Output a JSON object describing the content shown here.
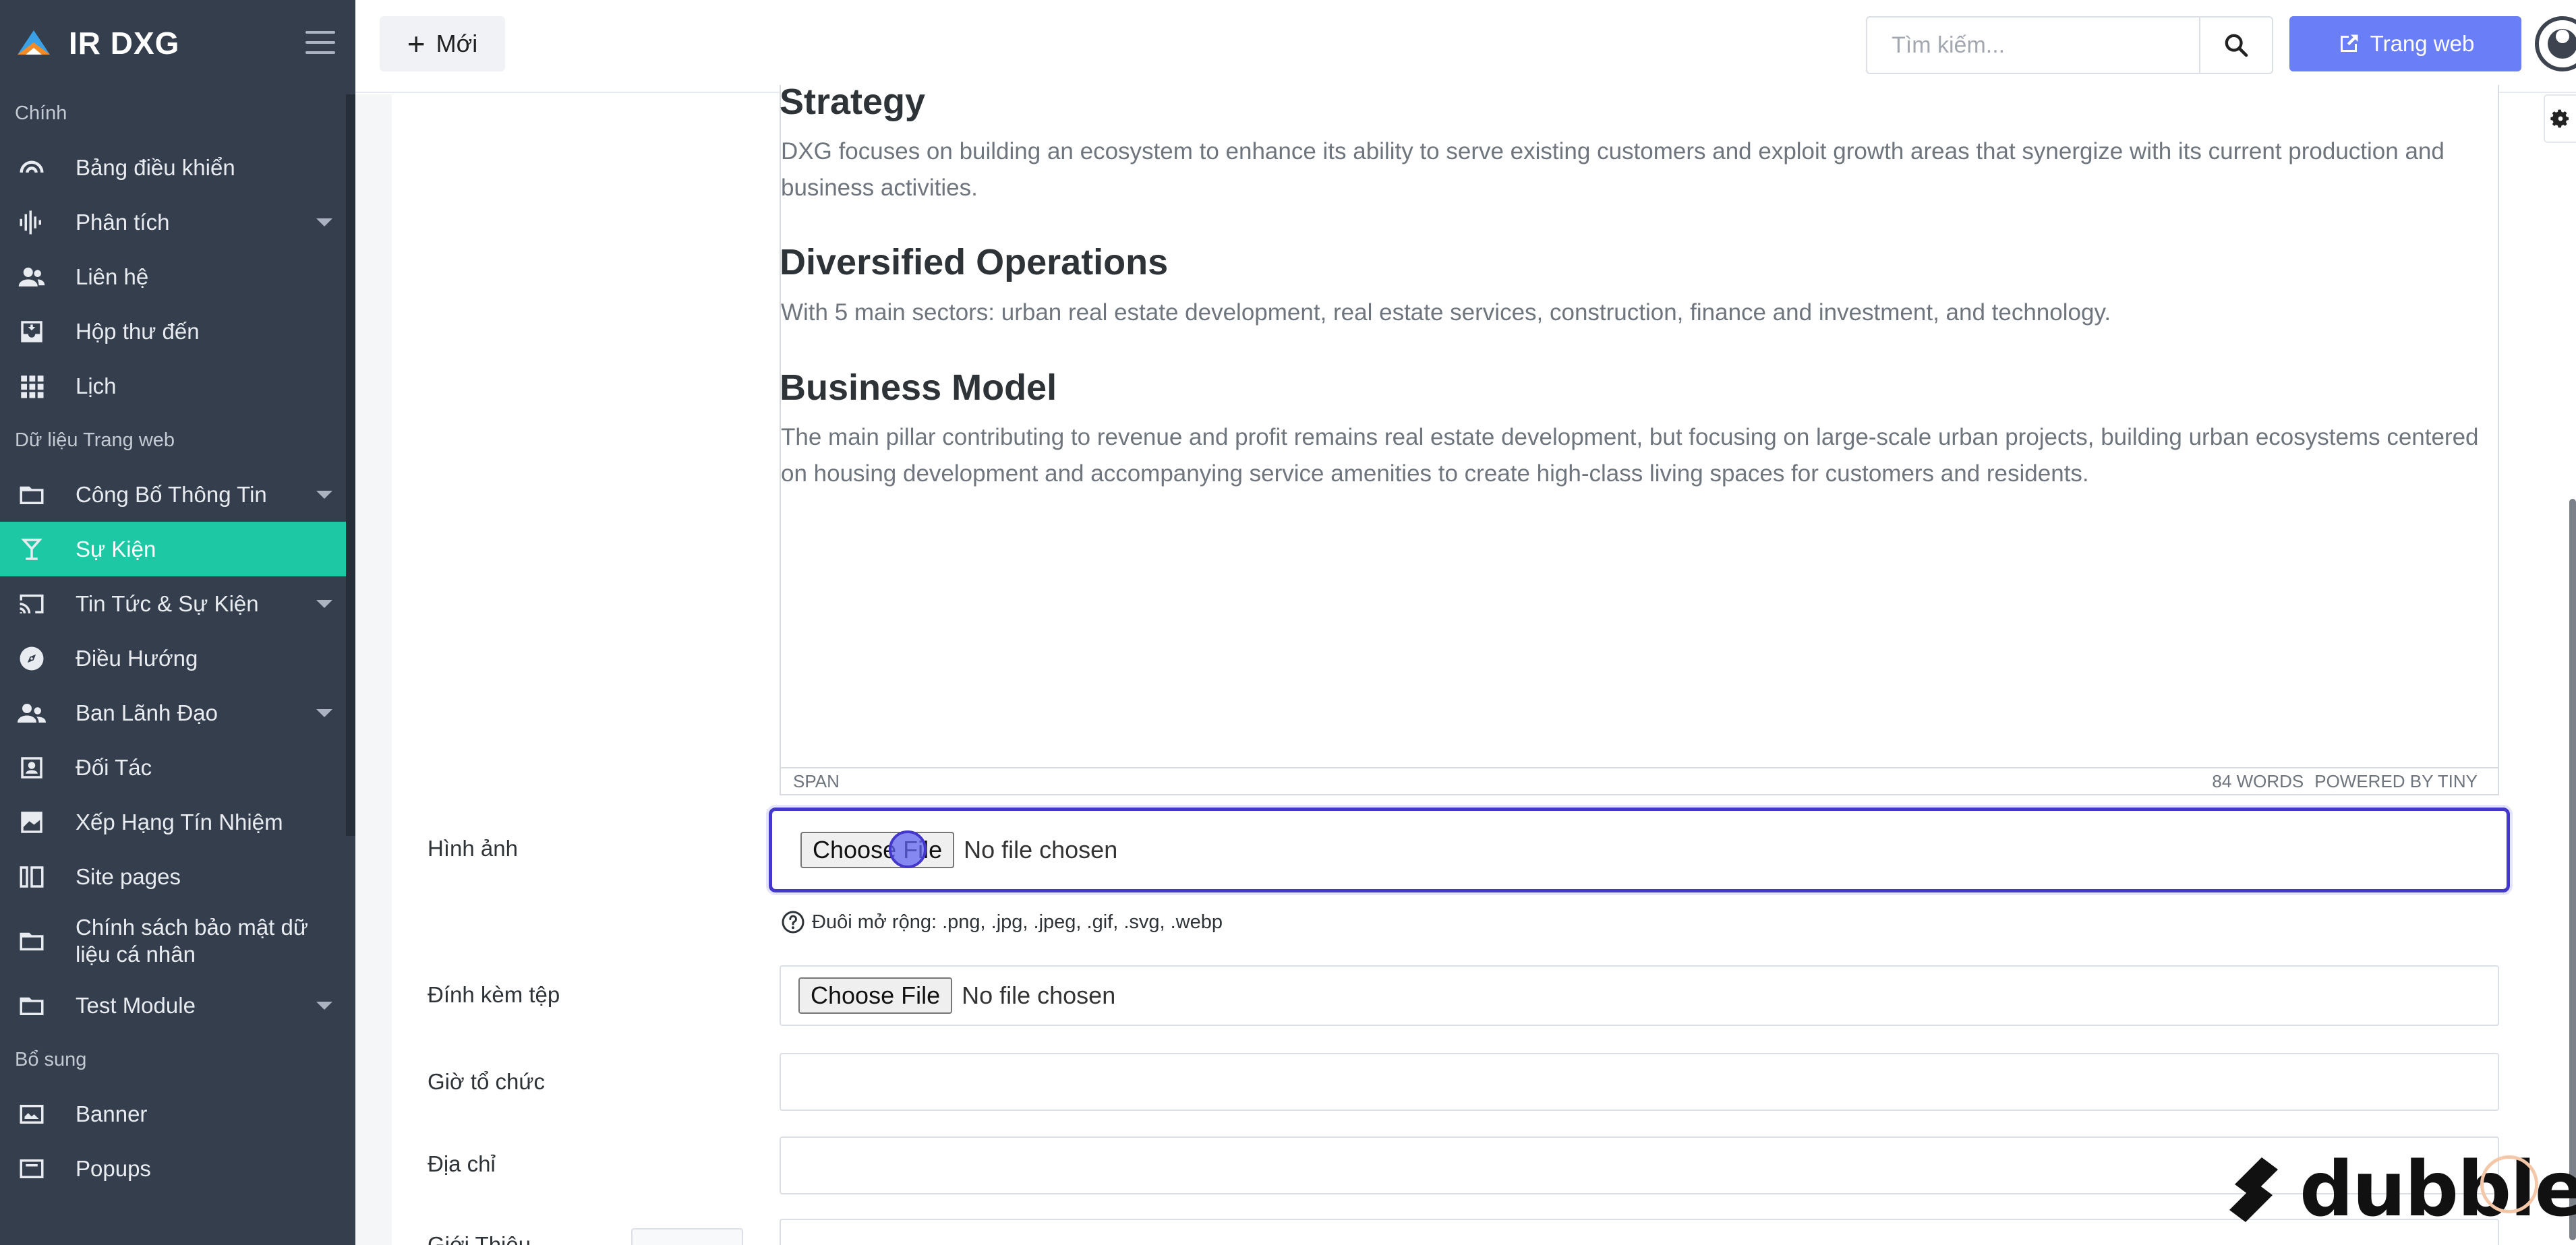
{
  "brand": {
    "name": "IR DXG"
  },
  "sidebar": {
    "sections": [
      {
        "label": "Chính",
        "items": [
          {
            "label": "Bảng điều khiển",
            "icon": "dashboard-icon"
          },
          {
            "label": "Phân tích",
            "icon": "analytics-icon",
            "has_submenu": true
          },
          {
            "label": "Liên hệ",
            "icon": "contacts-icon"
          },
          {
            "label": "Hộp thư đến",
            "icon": "inbox-icon"
          },
          {
            "label": "Lịch",
            "icon": "calendar-grid-icon"
          }
        ]
      },
      {
        "label": "Dữ liệu Trang web",
        "items": [
          {
            "label": "Công Bố Thông Tin",
            "icon": "folder-icon",
            "has_submenu": true
          },
          {
            "label": "Sự Kiện",
            "icon": "cocktail-icon",
            "active": true
          },
          {
            "label": "Tin Tức & Sự Kiện",
            "icon": "cast-icon",
            "has_submenu": true
          },
          {
            "label": "Điều Hướng",
            "icon": "compass-icon"
          },
          {
            "label": "Ban Lãnh Đạo",
            "icon": "people-icon",
            "has_submenu": true
          },
          {
            "label": "Đối Tác",
            "icon": "contact-card-icon"
          },
          {
            "label": "Xếp Hạng Tín Nhiệm",
            "icon": "rating-chart-icon"
          },
          {
            "label": "Site pages",
            "icon": "pages-icon"
          },
          {
            "label": "Chính sách bảo mật dữ liệu cá nhân",
            "icon": "folder-icon"
          },
          {
            "label": "Test Module",
            "icon": "folder-icon",
            "has_submenu": true
          }
        ]
      },
      {
        "label": "Bổ sung",
        "items": [
          {
            "label": "Banner",
            "icon": "banner-icon"
          },
          {
            "label": "Popups",
            "icon": "popup-icon"
          }
        ]
      }
    ]
  },
  "topbar": {
    "new_label": "Mới",
    "search_placeholder": "Tìm kiếm...",
    "website_label": "Trang web"
  },
  "editor": {
    "blocks": [
      {
        "heading": "Strategy",
        "text": "DXG focuses on building an ecosystem to enhance its ability to serve existing customers and exploit growth areas that synergize with its current production and business activities."
      },
      {
        "heading": "Diversified Operations",
        "text": "With 5 main sectors: urban real estate development, real estate services, construction, finance and investment, and technology."
      },
      {
        "heading": "Business Model",
        "text": "The main pillar contributing to revenue and profit remains real estate development, but focusing on large-scale urban projects, building urban ecosystems centered on housing development and accompanying service amenities to create high-class living spaces for customers and residents."
      }
    ],
    "status_path": "SPAN",
    "word_count": "84 WORDS",
    "powered_by": "POWERED BY TINY"
  },
  "form": {
    "image": {
      "label": "Hình ảnh",
      "button": "Choose File",
      "status": "No file chosen",
      "hint": "Đuôi mở rộng: .png, .jpg, .jpeg, .gif, .svg, .webp"
    },
    "attachment": {
      "label": "Đính kèm tệp",
      "button": "Choose File",
      "status": "No file chosen"
    },
    "time": {
      "label": "Giờ tổ chức"
    },
    "address": {
      "label": "Địa chỉ"
    },
    "intro": {
      "label": "Giới Thiệu"
    }
  },
  "watermark": {
    "text": "dubble"
  },
  "colors": {
    "sidebar_bg": "#343e4c",
    "active": "#1dc9a4",
    "primary": "#6a7ff7",
    "focus": "#4338ca"
  }
}
